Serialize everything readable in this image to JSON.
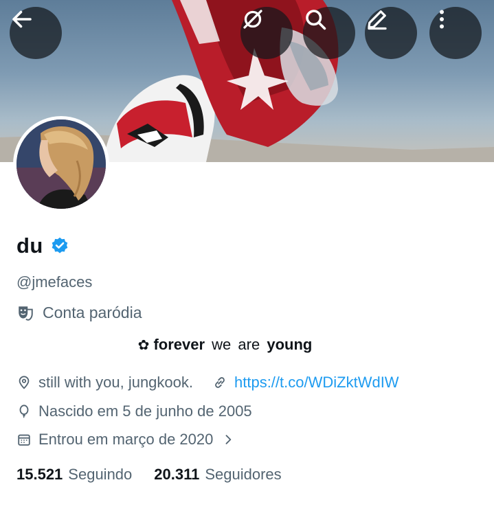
{
  "profile": {
    "name": "du",
    "handle": "@jmefaces",
    "parody_label": "Conta paródia",
    "bio": {
      "flower": "✿",
      "word1": "forever",
      "word2": "we",
      "word3": "are",
      "word4": "young"
    },
    "location": "still with you, jungkook.",
    "website": "https://t.co/WDiZktWdIW",
    "birthday": "Nascido em 5 de junho de 2005",
    "joined": "Entrou em março de 2020",
    "following_count": "15.521",
    "following_label": "Seguindo",
    "followers_count": "20.311",
    "followers_label": "Seguidores"
  },
  "header_actions": {
    "back_icon": "arrow-left-icon",
    "grok_icon": "grok-icon",
    "search_icon": "search-icon",
    "edit_icon": "pencil-icon",
    "more_icon": "more-vertical-icon"
  },
  "colors": {
    "accent": "#1d9bf0",
    "text_primary": "#0f1419",
    "text_secondary": "#536471",
    "helmet_red": "#c8202e"
  }
}
